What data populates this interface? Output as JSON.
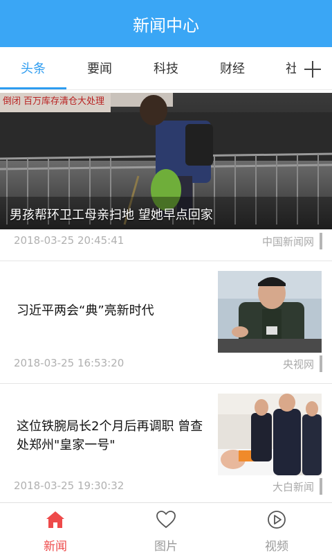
{
  "header": {
    "title": "新闻中心"
  },
  "tabs": [
    {
      "label": "头条",
      "active": true
    },
    {
      "label": "要闻"
    },
    {
      "label": "科技"
    },
    {
      "label": "财经"
    },
    {
      "label": "社"
    }
  ],
  "feed": {
    "hero": {
      "title": "男孩帮环卫工母亲扫地 望她早点回家",
      "date": "2018-03-25 20:45:41",
      "source": "中国新闻网",
      "image_signs": [
        "倒闭",
        "百万库存清仓大处理"
      ]
    },
    "items": [
      {
        "title": "习近平两会“典”亮新时代",
        "date": "2018-03-25 16:53:20",
        "source": "央视网"
      },
      {
        "title": "这位铁腕局长2个月后再调职 曾查处郑州\"皇家一号\"",
        "date": "2018-03-25 19:30:32",
        "source": "大白新闻"
      }
    ]
  },
  "bottom_nav": [
    {
      "label": "新闻",
      "icon": "home-icon",
      "active": true
    },
    {
      "label": "图片",
      "icon": "heart-icon"
    },
    {
      "label": "视频",
      "icon": "play-icon"
    }
  ],
  "colors": {
    "header": "#3aa6f5",
    "tab_active": "#2d9cf0",
    "nav_active": "#ee4a4a"
  }
}
